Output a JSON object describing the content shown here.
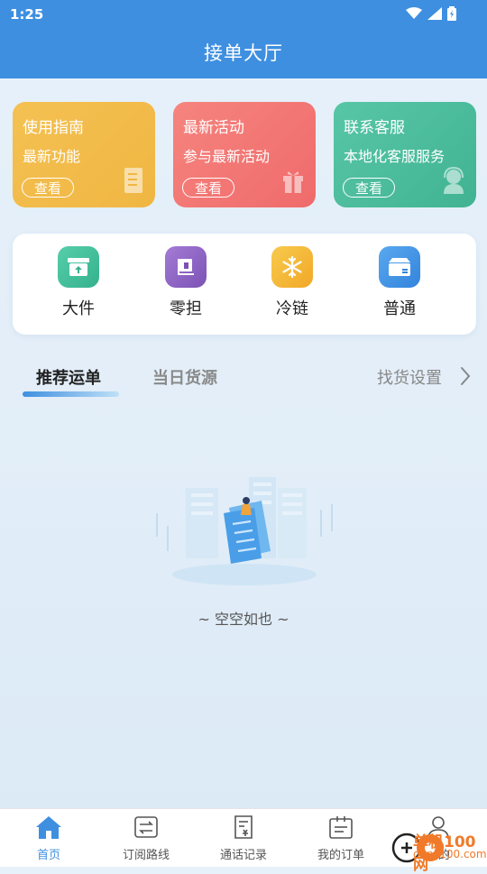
{
  "status": {
    "time": "1:25"
  },
  "header": {
    "title": "接单大厅"
  },
  "cards": [
    {
      "title": "使用指南",
      "subtitle": "最新功能",
      "button": "查看",
      "icon": "book-icon"
    },
    {
      "title": "最新活动",
      "subtitle": "参与最新活动",
      "button": "查看",
      "icon": "gift-icon"
    },
    {
      "title": "联系客服",
      "subtitle": "本地化客服服务",
      "button": "查看",
      "icon": "headset-icon"
    }
  ],
  "categories": [
    {
      "label": "大件",
      "icon": "box-upload-icon",
      "color": "#3fbf9a"
    },
    {
      "label": "零担",
      "icon": "pallet-icon",
      "color": "#8f63c4"
    },
    {
      "label": "冷链",
      "icon": "snowflake-icon",
      "color": "#f3b533"
    },
    {
      "label": "普通",
      "icon": "parcel-icon",
      "color": "#3f8fe0"
    }
  ],
  "tabs": {
    "recommended": "推荐运单",
    "today": "当日货源",
    "settings": "找货设置"
  },
  "empty": {
    "text": "~ 空空如也 ~"
  },
  "nav": [
    {
      "label": "首页",
      "icon": "home-icon",
      "active": true
    },
    {
      "label": "订阅路线",
      "icon": "route-icon"
    },
    {
      "label": "通话记录",
      "icon": "call-record-icon"
    },
    {
      "label": "我的订单",
      "icon": "order-icon"
    },
    {
      "label": "我的",
      "icon": "profile-icon"
    }
  ],
  "watermark": {
    "brand": "单机100网",
    "url": "danji100.com"
  },
  "colors": {
    "primary": "#3f8fe0"
  }
}
